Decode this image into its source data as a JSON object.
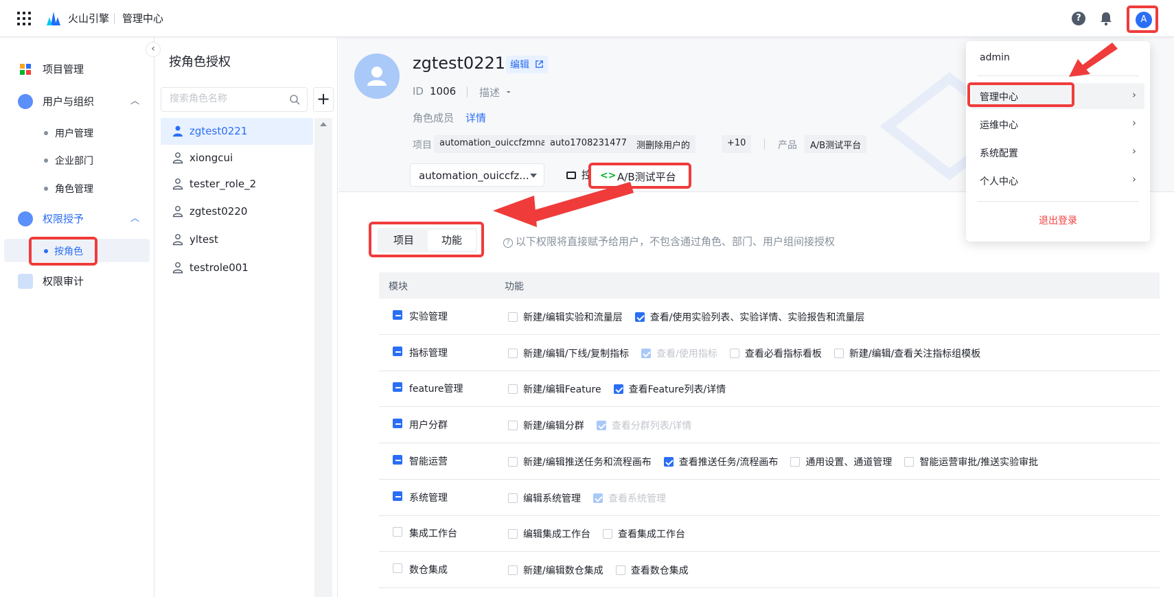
{
  "header": {
    "brand": "火山引擎",
    "subtitle": "管理中心",
    "avatar_letter": "A"
  },
  "nav": {
    "project_mgmt": "项目管理",
    "users_orgs": "用户与组织",
    "user_mgmt": "用户管理",
    "enterprise_dept": "企业部门",
    "role_mgmt": "角色管理",
    "perm_grant": "权限授予",
    "by_role": "按角色",
    "perm_audit": "权限审计"
  },
  "role_panel": {
    "title": "按角色授权",
    "search_placeholder": "搜索角色名称",
    "add_label": "+",
    "roles": [
      "zgtest0221",
      "xiongcui",
      "tester_role_2",
      "zgtest0220",
      "yltest",
      "testrole001"
    ]
  },
  "role_detail": {
    "name": "zgtest0221",
    "edit_label": "编辑",
    "id_label": "ID",
    "id_value": "1006",
    "desc_label": "描述",
    "desc_value": "-",
    "members_label": "角色成员",
    "members_link": "详情",
    "project_label": "项目",
    "project_tags": [
      "automation_ouiccfzmna",
      "auto1708231477",
      "测删除用户的",
      "+10"
    ],
    "product_label": "产品",
    "product_tag": "A/B测试平台",
    "project_select": "automation_ouiccfz...",
    "tab_console": "控制台",
    "tab_ab": "A/B测试平台"
  },
  "toggle": {
    "project": "项目",
    "function": "功能"
  },
  "hint": "以下权限将直接赋予给用户，不包含通过角色、部门、用户组间接授权",
  "table": {
    "col_module": "模块",
    "col_function": "功能",
    "rows": [
      {
        "module": "实验管理",
        "state": "ind",
        "funcs": [
          {
            "label": "新建/编辑实验和流量层",
            "state": "off"
          },
          {
            "label": "查看/使用实验列表、实验详情、实验报告和流量层",
            "state": "on"
          }
        ]
      },
      {
        "module": "指标管理",
        "state": "ind",
        "funcs": [
          {
            "label": "新建/编辑/下线/复制指标",
            "state": "off"
          },
          {
            "label": "查看/使用指标",
            "state": "dim"
          },
          {
            "label": "查看必看指标看板",
            "state": "off"
          },
          {
            "label": "新建/编辑/查看关注指标组模板",
            "state": "off"
          }
        ]
      },
      {
        "module": "feature管理",
        "state": "ind",
        "funcs": [
          {
            "label": "新建/编辑Feature",
            "state": "off"
          },
          {
            "label": "查看Feature列表/详情",
            "state": "on"
          }
        ]
      },
      {
        "module": "用户分群",
        "state": "ind",
        "funcs": [
          {
            "label": "新建/编辑分群",
            "state": "off"
          },
          {
            "label": "查看分群列表/详情",
            "state": "dim"
          }
        ]
      },
      {
        "module": "智能运营",
        "state": "ind",
        "funcs": [
          {
            "label": "新建/编辑推送任务和流程画布",
            "state": "off"
          },
          {
            "label": "查看推送任务/流程画布",
            "state": "on"
          },
          {
            "label": "通用设置、通道管理",
            "state": "off"
          },
          {
            "label": "智能运营审批/推送实验审批",
            "state": "off"
          }
        ]
      },
      {
        "module": "系统管理",
        "state": "ind",
        "funcs": [
          {
            "label": "编辑系统管理",
            "state": "off"
          },
          {
            "label": "查看系统管理",
            "state": "dim"
          }
        ]
      },
      {
        "module": "集成工作台",
        "state": "off",
        "funcs": [
          {
            "label": "编辑集成工作台",
            "state": "off"
          },
          {
            "label": "查看集成工作台",
            "state": "off"
          }
        ]
      },
      {
        "module": "数仓集成",
        "state": "off",
        "funcs": [
          {
            "label": "新建/编辑数仓集成",
            "state": "off"
          },
          {
            "label": "查看数仓集成",
            "state": "off"
          }
        ]
      }
    ]
  },
  "dropdown": {
    "user": "admin",
    "items": [
      "管理中心",
      "运维中心",
      "系统配置",
      "个人中心"
    ],
    "logout": "退出登录"
  },
  "colors": {
    "accent": "#2a6ef5",
    "highlight": "#f03b3b",
    "danger": "#f53f3f"
  },
  "icons": [
    "apps-grid-icon",
    "volcano-logo-icon",
    "help-icon",
    "bell-icon",
    "search-icon",
    "user-icon",
    "monitor-icon",
    "ab-test-icon",
    "external-link-icon",
    "chevron-right-icon",
    "chevron-up-icon",
    "chevron-left-icon"
  ]
}
